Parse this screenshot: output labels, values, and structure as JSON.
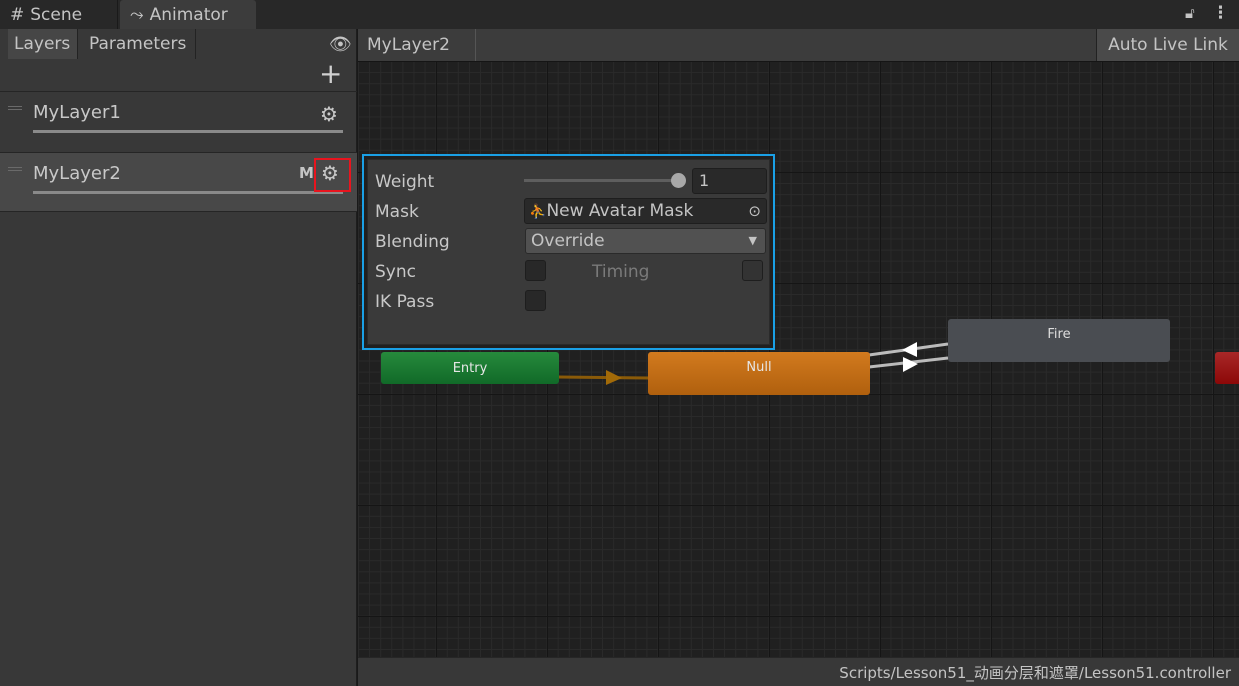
{
  "tabs": [
    {
      "label": "Scene",
      "icon": "grid-hash-icon"
    },
    {
      "label": "Animator",
      "icon": "animator-icon",
      "active": true
    }
  ],
  "left_panel": {
    "tabs": [
      "Layers",
      "Parameters"
    ],
    "active_tab": "Layers",
    "layers": [
      {
        "name": "MyLayer1"
      },
      {
        "name": "MyLayer2",
        "badge": "M",
        "selected": true
      }
    ]
  },
  "breadcrumb": "MyLayer2",
  "auto_live_link": "Auto Live Link",
  "layer_settings": {
    "weight_label": "Weight",
    "weight_value": "1",
    "weight_slider": 1,
    "mask_label": "Mask",
    "mask_value": "New Avatar Mask",
    "blending_label": "Blending",
    "blending_value": "Override",
    "sync_label": "Sync",
    "timing_label": "Timing",
    "ik_pass_label": "IK Pass",
    "sync": false,
    "timing": false,
    "ik_pass": false
  },
  "states": {
    "entry": "Entry",
    "null": "Null",
    "fire": "Fire"
  },
  "colors": {
    "highlight_popup": "#1aa0e6",
    "highlight_gear": "#e8141e",
    "entry": "#1b7a32",
    "default_state": "#cf7418",
    "exit": "#a01818"
  },
  "status_path": "Scripts/Lesson51_动画分层和遮罩/Lesson51.controller"
}
